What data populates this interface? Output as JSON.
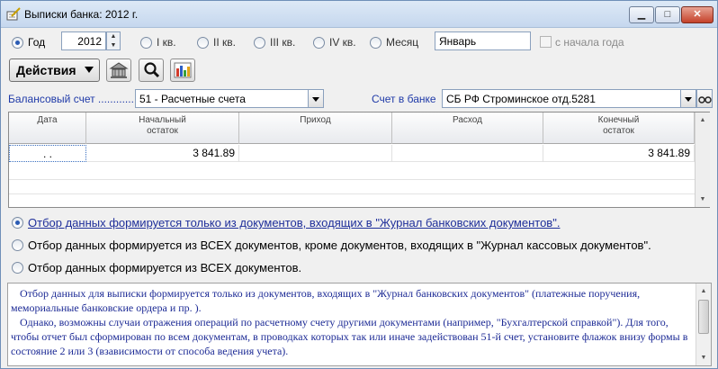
{
  "window": {
    "title": "Выписки банка: 2012 г."
  },
  "period": {
    "options": [
      {
        "label": "Год",
        "selected": true
      },
      {
        "label": "I кв.",
        "selected": false
      },
      {
        "label": "II кв.",
        "selected": false
      },
      {
        "label": "III кв.",
        "selected": false
      },
      {
        "label": "IV кв.",
        "selected": false
      },
      {
        "label": "Месяц",
        "selected": false
      }
    ],
    "year_value": "2012",
    "month_value": "Январь",
    "from_year_start_label": "с начала года",
    "from_year_start_checked": false
  },
  "toolbar": {
    "actions_label": "Действия"
  },
  "account": {
    "balance_label": "Балансовый счет ............",
    "balance_value": "51 - Расчетные счета",
    "bank_label": "Счет в банке",
    "bank_value": "СБ РФ Строминское отд.5281"
  },
  "grid": {
    "columns": [
      {
        "line1": "Дата",
        "line2": ""
      },
      {
        "line1": "Начальный",
        "line2": "остаток"
      },
      {
        "line1": "Приход",
        "line2": ""
      },
      {
        "line1": "Расход",
        "line2": ""
      },
      {
        "line1": "Конечный",
        "line2": "остаток"
      }
    ],
    "rows": [
      {
        "date": " .  .",
        "opening": "3 841.89",
        "income": "",
        "expense": "",
        "closing": "3 841.89"
      }
    ]
  },
  "filter_options": [
    {
      "label": "Отбор данных формируется только из документов, входящих в \"Журнал банковских документов\".",
      "selected": true
    },
    {
      "label": "Отбор данных формируется из ВСЕХ документов, кроме  документов, входящих в \"Журнал кассовых документов\".",
      "selected": false
    },
    {
      "label": "Отбор данных формируется из ВСЕХ документов.",
      "selected": false
    }
  ],
  "info": {
    "p1": "Отбор данных для выписки формируется только из документов, входящих в \"Журнал банковских документов\" (платежные поручения, мемориальные банковские ордера и пр. ).",
    "p2": "Однако, возможны случаи отражения операций по расчетному счету другими документами (например, \"Бухгалтерской справкой\"). Для того, чтобы отчет был сформирован по всем документам, в проводках которых так или иначе задействован 51-й счет, установите флажок внизу формы в состояние 2 или 3 (взависимости от способа ведения учета)."
  },
  "icons": {
    "title": "pen-notepad-icon",
    "tool1": "bank-building-icon",
    "tool2": "magnifier-icon",
    "tool3": "chart-icon",
    "bank_lookup": "glasses-icon"
  }
}
